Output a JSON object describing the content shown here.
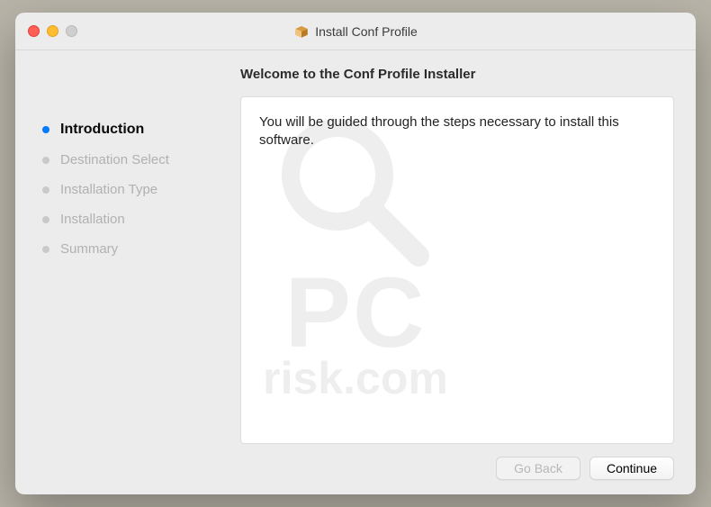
{
  "window": {
    "title": "Install Conf Profile"
  },
  "heading": "Welcome to the Conf Profile Installer",
  "sidebar": {
    "steps": [
      {
        "label": "Introduction",
        "state": "active"
      },
      {
        "label": "Destination Select",
        "state": "inactive"
      },
      {
        "label": "Installation Type",
        "state": "inactive"
      },
      {
        "label": "Installation",
        "state": "inactive"
      },
      {
        "label": "Summary",
        "state": "inactive"
      }
    ]
  },
  "panel": {
    "text": "You will be guided through the steps necessary to install this software."
  },
  "footer": {
    "back_label": "Go Back",
    "continue_label": "Continue"
  },
  "watermark": {
    "line1": "PC",
    "line2": "risk.com"
  }
}
